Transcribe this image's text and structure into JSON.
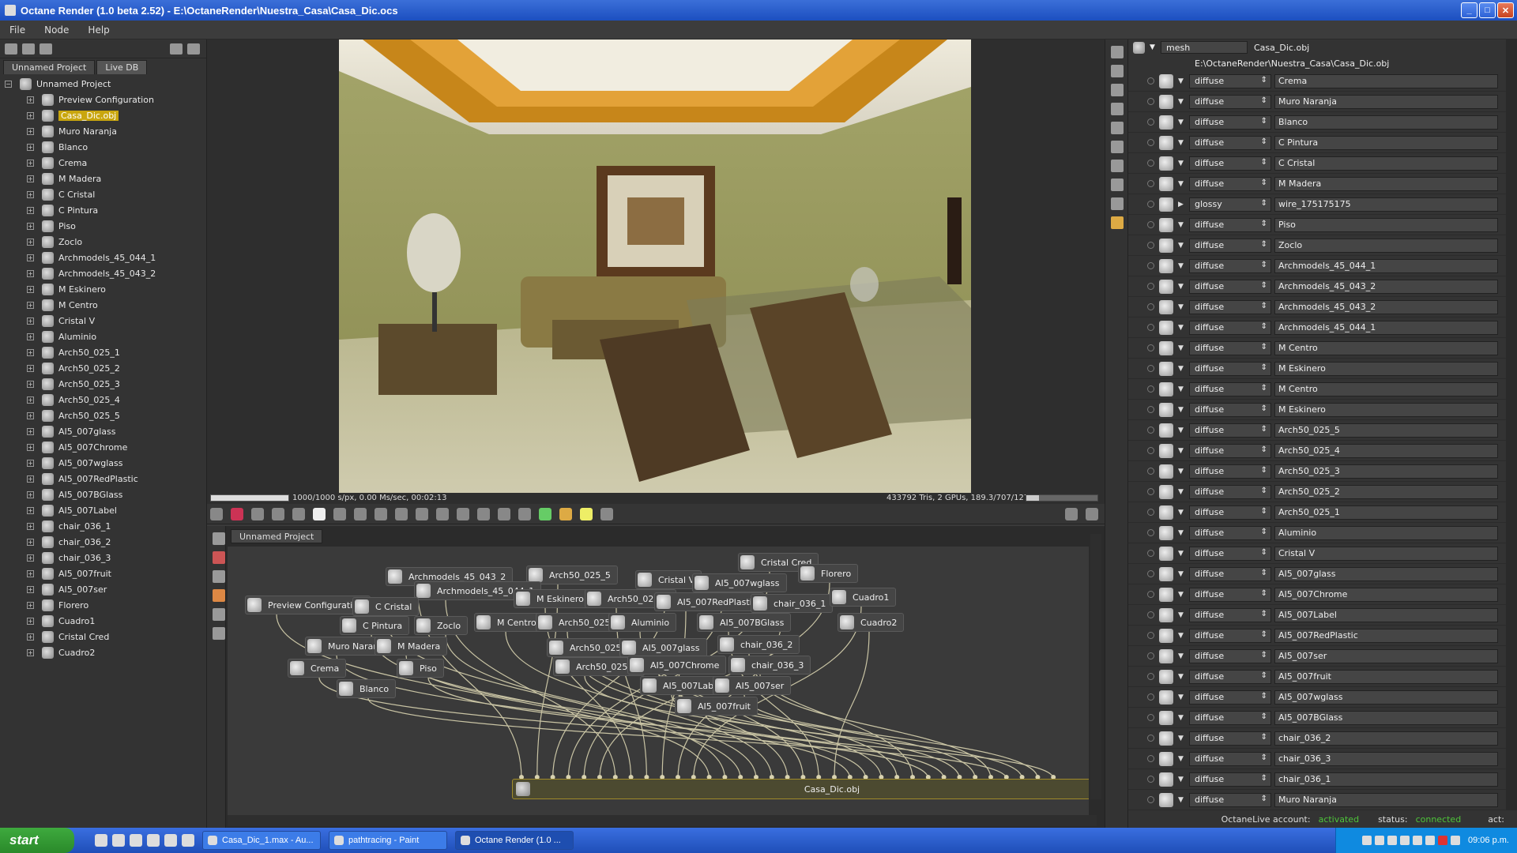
{
  "window": {
    "title": "Octane Render (1.0 beta 2.52) - E:\\OctaneRender\\Nuestra_Casa\\Casa_Dic.ocs"
  },
  "menu": [
    "File",
    "Node",
    "Help"
  ],
  "left": {
    "tabs": [
      "Unnamed Project",
      "Live DB"
    ],
    "root": "Unnamed Project",
    "items": [
      "Preview Configuration",
      "Casa_Dic.obj",
      "Muro Naranja",
      "Blanco",
      "Crema",
      "M Madera",
      "C Cristal",
      "C Pintura",
      "Piso",
      "Zoclo",
      "Archmodels_45_044_1",
      "Archmodels_45_043_2",
      "M Eskinero",
      "M Centro",
      "Cristal V",
      "Aluminio",
      "Arch50_025_1",
      "Arch50_025_2",
      "Arch50_025_3",
      "Arch50_025_4",
      "Arch50_025_5",
      "AI5_007glass",
      "AI5_007Chrome",
      "AI5_007wglass",
      "AI5_007RedPlastic",
      "AI5_007BGlass",
      "AI5_007Label",
      "chair_036_1",
      "chair_036_2",
      "chair_036_3",
      "AI5_007fruit",
      "AI5_007ser",
      "Florero",
      "Cuadro1",
      "Cristal Cred",
      "Cuadro2"
    ],
    "selected_index": 1
  },
  "viewport": {
    "stats_left": "1000/1000 s/px, 0.00 Ms/sec, 00:02:13",
    "stats_right": "433792 Tris, 2 GPUs, 189.3/707/1279 MB",
    "progress": 1.0
  },
  "nodegraph": {
    "tab": "Unnamed Project",
    "nodes": [
      "Archmodels_45_043_2",
      "Arch50_025_5",
      "Cristal V",
      "AI5_007wglass",
      "Cristal Cred",
      "Florero",
      "Archmodels_45_044_1",
      "M Eskinero",
      "Arch50_025_1",
      "AI5_007RedPlastic",
      "chair_036_1",
      "Cuadro1",
      "Preview Configuration",
      "C Cristal",
      "C Pintura",
      "Zoclo",
      "M Centro",
      "Arch50_025_4",
      "Aluminio",
      "AI5_007BGlass",
      "Cuadro2",
      "Muro Naranja",
      "M Madera",
      "Arch50_025_3",
      "AI5_007glass",
      "chair_036_2",
      "Crema",
      "Piso",
      "Arch50_025_2",
      "AI5_007Chrome",
      "chair_036_3",
      "Blanco",
      "AI5_007Label",
      "AI5_007ser",
      "AI5_007fruit"
    ],
    "mesh_node": "Casa_Dic.obj"
  },
  "right": {
    "mesh_type": "mesh",
    "mesh_name": "Casa_Dic.obj",
    "path": "E:\\OctaneRender\\Nuestra_Casa\\Casa_Dic.obj",
    "materials": [
      {
        "type": "diffuse",
        "name": "Crema"
      },
      {
        "type": "diffuse",
        "name": "Muro Naranja"
      },
      {
        "type": "diffuse",
        "name": "Blanco"
      },
      {
        "type": "diffuse",
        "name": "C Pintura"
      },
      {
        "type": "diffuse",
        "name": "C Cristal"
      },
      {
        "type": "diffuse",
        "name": "M Madera"
      },
      {
        "type": "glossy",
        "name": "wire_175175175"
      },
      {
        "type": "diffuse",
        "name": "Piso"
      },
      {
        "type": "diffuse",
        "name": "Zoclo"
      },
      {
        "type": "diffuse",
        "name": "Archmodels_45_044_1"
      },
      {
        "type": "diffuse",
        "name": "Archmodels_45_043_2"
      },
      {
        "type": "diffuse",
        "name": "Archmodels_45_043_2"
      },
      {
        "type": "diffuse",
        "name": "Archmodels_45_044_1"
      },
      {
        "type": "diffuse",
        "name": "M Centro"
      },
      {
        "type": "diffuse",
        "name": "M Eskinero"
      },
      {
        "type": "diffuse",
        "name": "M Centro"
      },
      {
        "type": "diffuse",
        "name": "M Eskinero"
      },
      {
        "type": "diffuse",
        "name": "Arch50_025_5"
      },
      {
        "type": "diffuse",
        "name": "Arch50_025_4"
      },
      {
        "type": "diffuse",
        "name": "Arch50_025_3"
      },
      {
        "type": "diffuse",
        "name": "Arch50_025_2"
      },
      {
        "type": "diffuse",
        "name": "Arch50_025_1"
      },
      {
        "type": "diffuse",
        "name": "Aluminio"
      },
      {
        "type": "diffuse",
        "name": "Cristal V"
      },
      {
        "type": "diffuse",
        "name": "AI5_007glass"
      },
      {
        "type": "diffuse",
        "name": "AI5_007Chrome"
      },
      {
        "type": "diffuse",
        "name": "AI5_007Label"
      },
      {
        "type": "diffuse",
        "name": "AI5_007RedPlastic"
      },
      {
        "type": "diffuse",
        "name": "AI5_007ser"
      },
      {
        "type": "diffuse",
        "name": "AI5_007fruit"
      },
      {
        "type": "diffuse",
        "name": "AI5_007wglass"
      },
      {
        "type": "diffuse",
        "name": "AI5_007BGlass"
      },
      {
        "type": "diffuse",
        "name": "chair_036_2"
      },
      {
        "type": "diffuse",
        "name": "chair_036_3"
      },
      {
        "type": "diffuse",
        "name": "chair_036_1"
      },
      {
        "type": "diffuse",
        "name": "Muro Naranja"
      }
    ],
    "status": {
      "account_label": "OctaneLive account:",
      "account_value": "activated",
      "status_label": "status:",
      "status_value": "connected",
      "act_label": "act:"
    }
  },
  "taskbar": {
    "start": "start",
    "items": [
      "Casa_Dic_1.max - Au...",
      "pathtracing - Paint",
      "Octane Render (1.0 ..."
    ],
    "clock": "09:06 p.m."
  },
  "colors": {
    "accent": "#c9a60e",
    "status_green": "#4ec43a",
    "titlebar": "#1c4fc0"
  }
}
